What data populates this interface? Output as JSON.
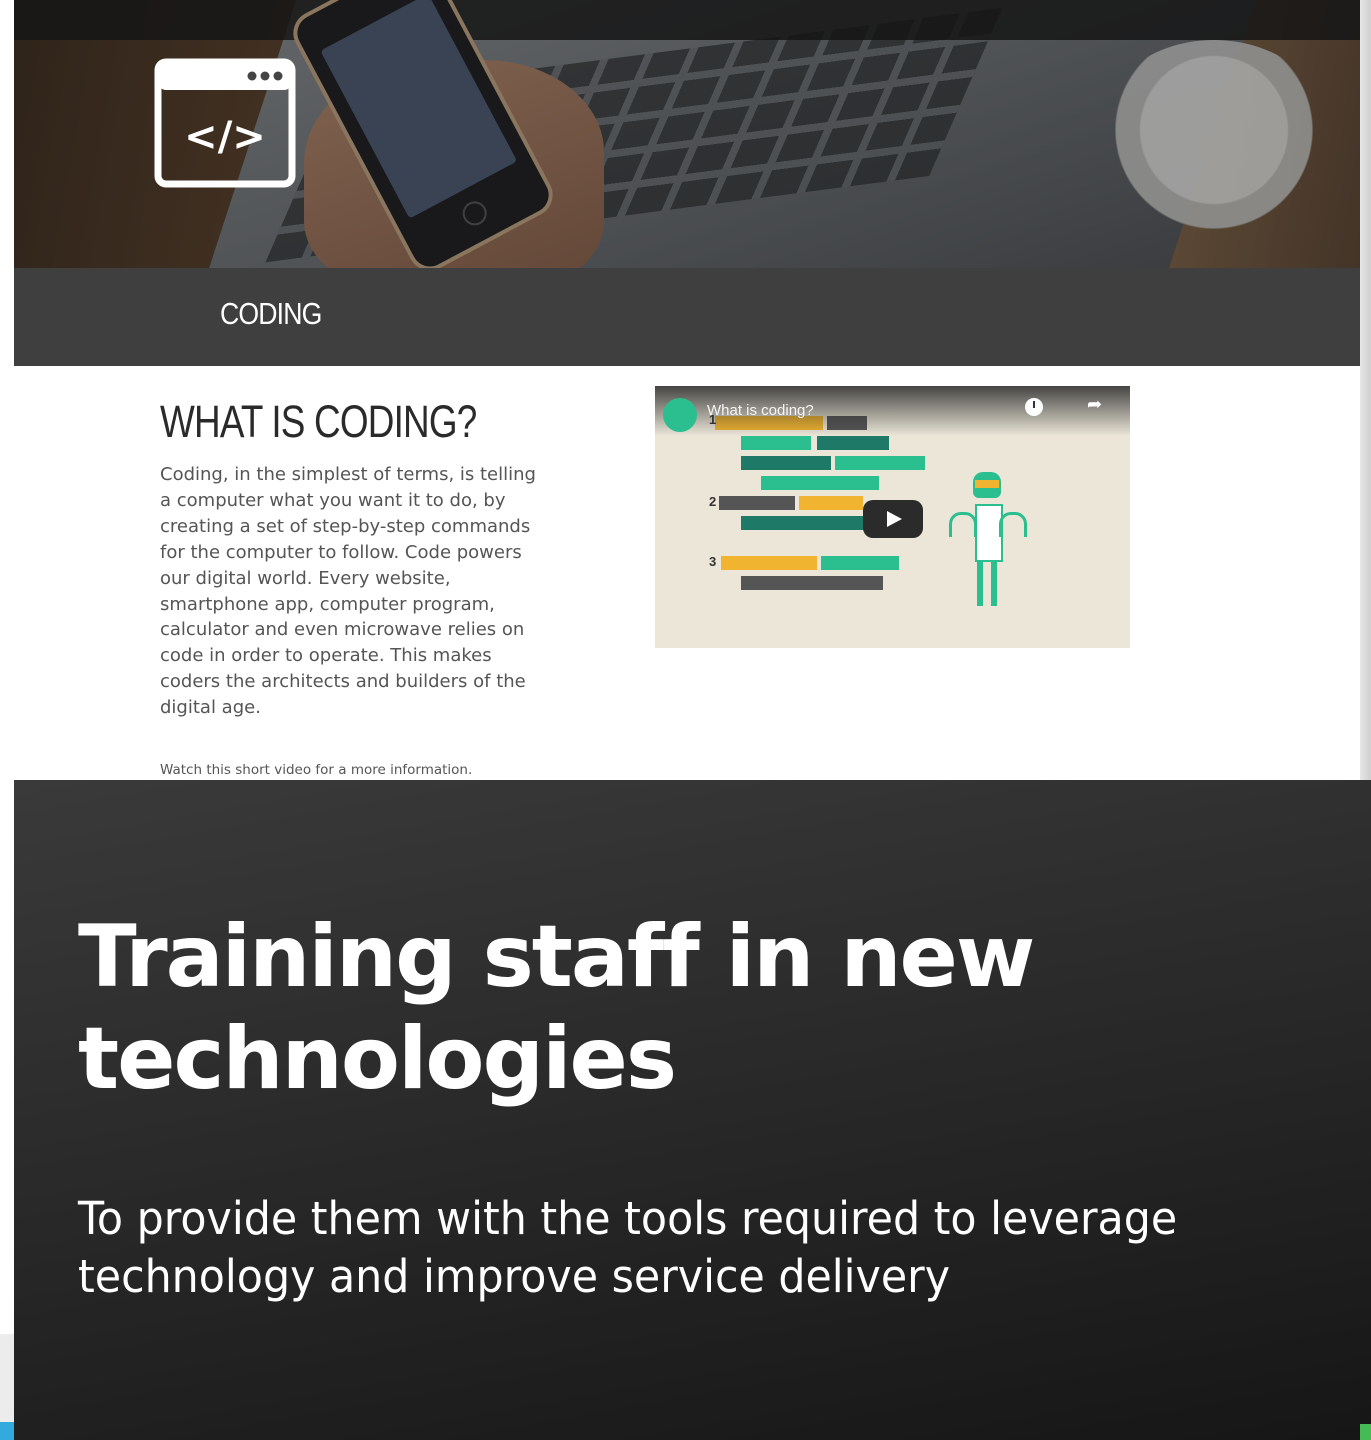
{
  "header": {
    "icon": "code-window-icon",
    "category_label": "CODING"
  },
  "article": {
    "heading": "WHAT IS CODING?",
    "body": "Coding, in the simplest of terms, is telling a computer what you want it to do, by creating a set of step-by-step commands for the computer to follow. Code powers our digital world. Every website, smartphone app, computer program, calculator and even microwave relies on code in order to operate. This makes coders the architects and builders of the digital age.",
    "video_note": "Watch this short video for a more information."
  },
  "video": {
    "title": "What is coding?",
    "step_numbers": [
      "1",
      "2",
      "3"
    ],
    "colors": {
      "green": "#2bbf8f",
      "teal": "#1e7a66",
      "yellow": "#f0b430",
      "gray": "#555555"
    }
  },
  "slide": {
    "title": "Training staff in new technologies",
    "subtitle": "To provide them with the tools required to leverage technology and improve service delivery"
  }
}
